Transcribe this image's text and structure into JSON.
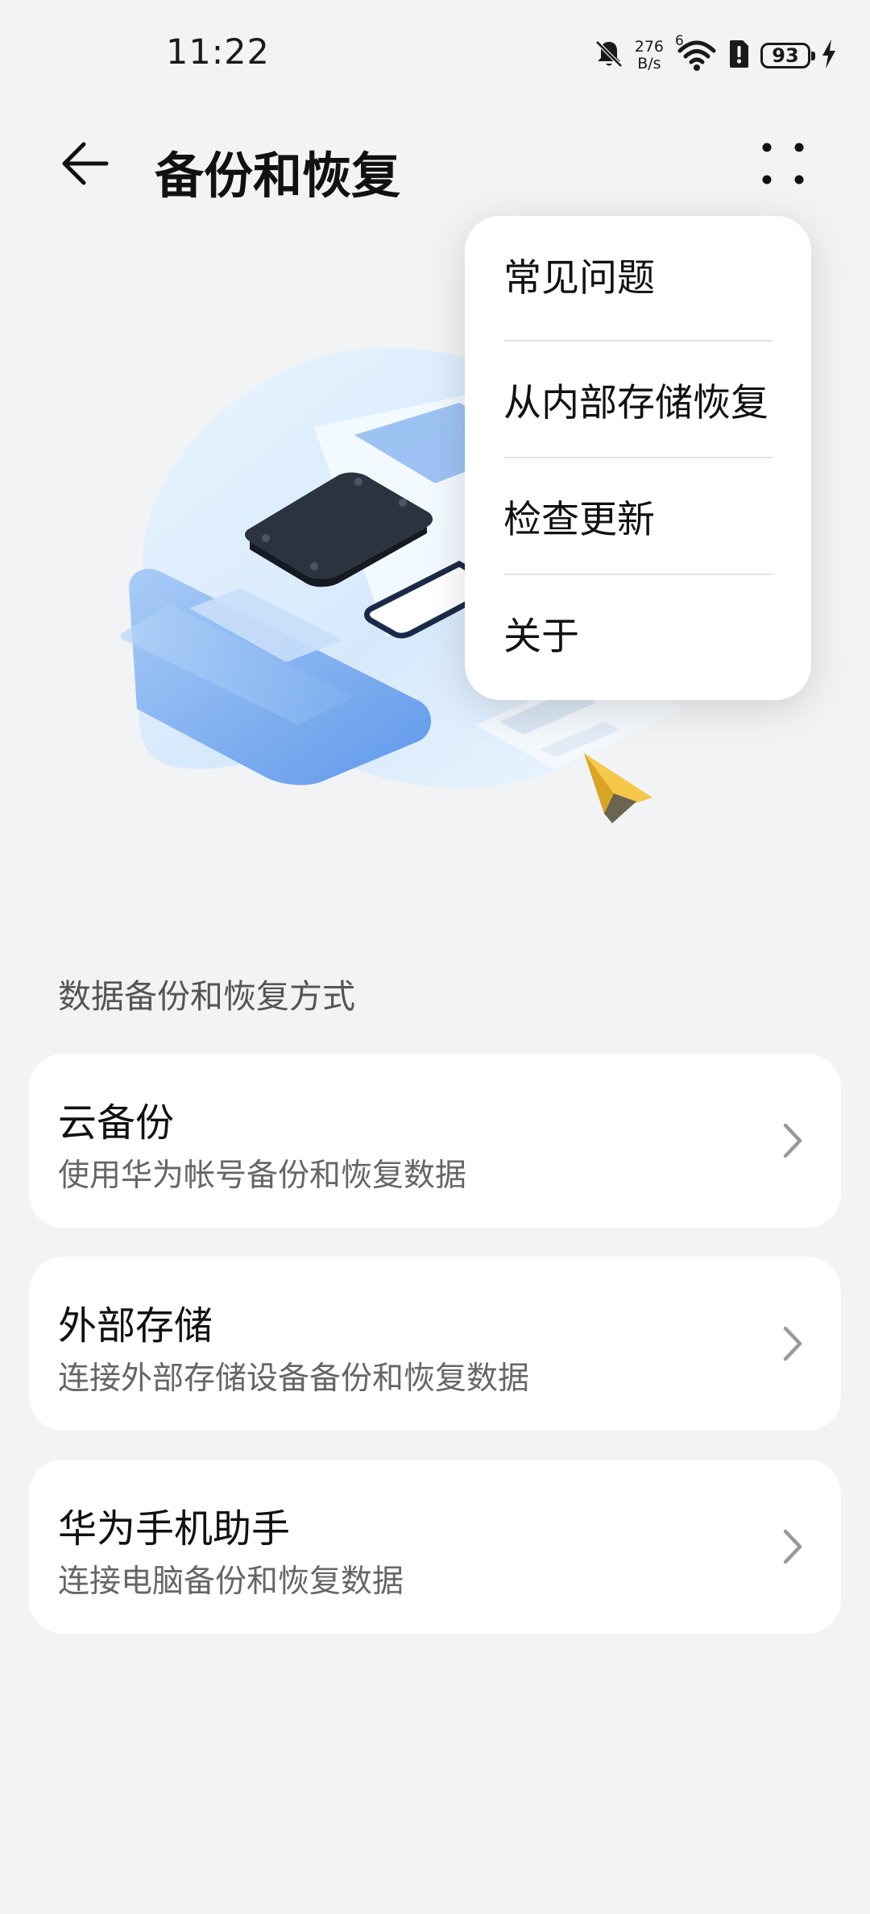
{
  "status_bar": {
    "time": "11:22",
    "net_speed_value": "276",
    "net_speed_unit": "B/s",
    "wifi_badge": "6",
    "battery_level": "93",
    "icons": [
      "bell-muted-icon",
      "wifi-icon",
      "sim-alert-icon",
      "battery-icon",
      "charging-icon"
    ]
  },
  "header": {
    "title": "备份和恢复",
    "back_icon": "arrow-left-icon",
    "more_icon": "more-dots-icon"
  },
  "section": {
    "title": "数据备份和恢复方式"
  },
  "options": [
    {
      "title": "云备份",
      "subtitle": "使用华为帐号备份和恢复数据"
    },
    {
      "title": "外部存储",
      "subtitle": "连接外部存储设备备份和恢复数据"
    },
    {
      "title": "华为手机助手",
      "subtitle": "连接电脑备份和恢复数据"
    }
  ],
  "menu": {
    "items": [
      {
        "label": "常见问题"
      },
      {
        "label": "从内部存储恢复"
      },
      {
        "label": "检查更新"
      },
      {
        "label": "关于"
      }
    ]
  },
  "colors": {
    "background": "#f1f3f5",
    "card": "#ffffff",
    "illustration_blue": "#6fa3ec",
    "paper_plane": "#f5c84a"
  }
}
